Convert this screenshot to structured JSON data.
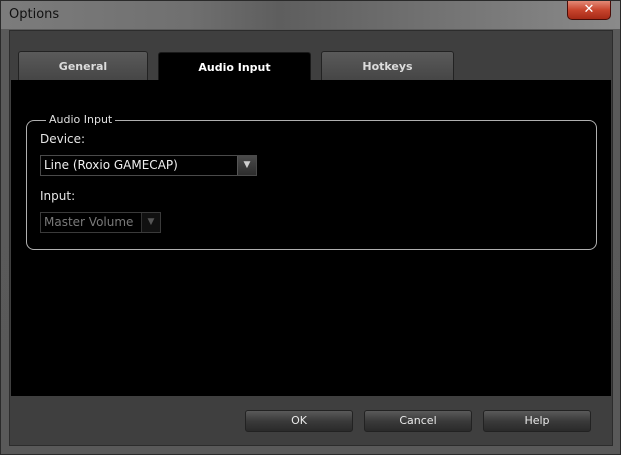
{
  "window": {
    "title": "Options",
    "close_glyph": "✕"
  },
  "tabs": [
    {
      "label": "General",
      "active": false
    },
    {
      "label": "Audio Input",
      "active": true
    },
    {
      "label": "Hotkeys",
      "active": false
    }
  ],
  "audio_input": {
    "group_label": "Audio Input",
    "device_label": "Device:",
    "device_value": "Line (Roxio GAMECAP)",
    "input_label": "Input:",
    "input_value": "Master Volume",
    "arrow_glyph": "▼"
  },
  "buttons": {
    "ok": "OK",
    "cancel": "Cancel",
    "help": "Help"
  }
}
